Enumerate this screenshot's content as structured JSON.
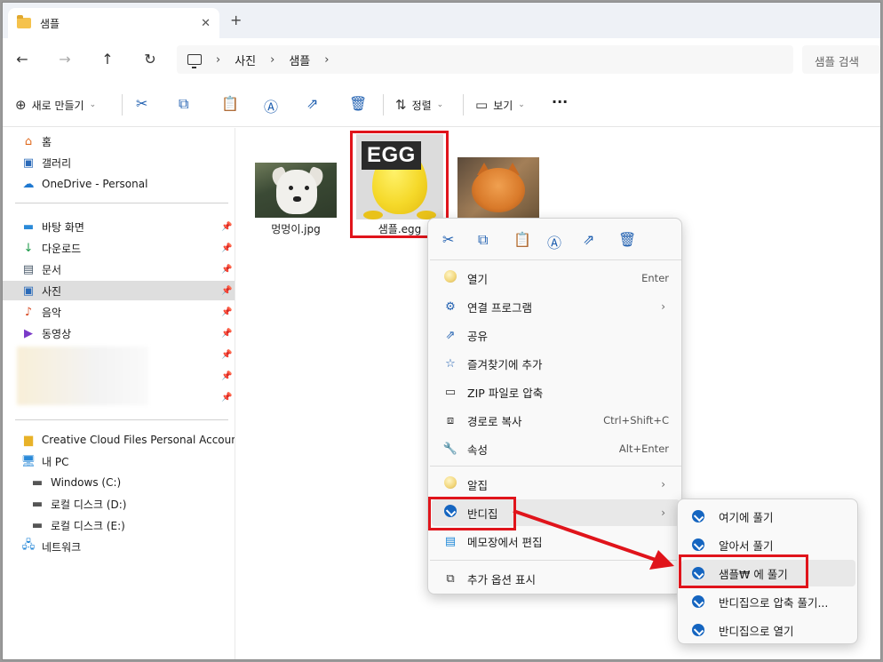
{
  "tab": {
    "title": "샘플",
    "close": "✕",
    "new": "+"
  },
  "address": {
    "crumbs": [
      "사진",
      "샘플"
    ],
    "search_placeholder": "샘플 검색"
  },
  "toolbar": {
    "new_label": "새로 만들기",
    "sort_label": "정렬",
    "view_label": "보기",
    "more": "···"
  },
  "sidebar": {
    "items": [
      {
        "label": "홈",
        "icon": "home-icon"
      },
      {
        "label": "갤러리",
        "icon": "gallery-icon"
      },
      {
        "label": "OneDrive - Personal",
        "icon": "onedrive-icon"
      },
      {
        "label": "바탕 화면",
        "icon": "desktop-icon"
      },
      {
        "label": "다운로드",
        "icon": "download-icon"
      },
      {
        "label": "문서",
        "icon": "documents-icon"
      },
      {
        "label": "사진",
        "icon": "pictures-icon"
      },
      {
        "label": "음악",
        "icon": "music-icon"
      },
      {
        "label": "동영상",
        "icon": "videos-icon"
      },
      {
        "label": "Creative Cloud Files Personal Account lif",
        "icon": "folder-icon"
      },
      {
        "label": "내 PC",
        "icon": "pc-icon"
      },
      {
        "label": "Windows (C:)",
        "icon": "drive-icon"
      },
      {
        "label": "로컬 디스크 (D:)",
        "icon": "drive-icon"
      },
      {
        "label": "로컬 디스크 (E:)",
        "icon": "drive-icon"
      },
      {
        "label": "네트워크",
        "icon": "network-icon"
      }
    ]
  },
  "files": [
    {
      "name": "멍멍이.jpg"
    },
    {
      "name": "샘플.egg",
      "thumb_text": "EGG"
    },
    {
      "name": ""
    }
  ],
  "context_menu": {
    "items": [
      {
        "label": "열기",
        "shortcut": "Enter"
      },
      {
        "label": "연결 프로그램"
      },
      {
        "label": "공유"
      },
      {
        "label": "즐겨찾기에 추가"
      },
      {
        "label": "ZIP 파일로 압축"
      },
      {
        "label": "경로로 복사",
        "shortcut": "Ctrl+Shift+C"
      },
      {
        "label": "속성",
        "shortcut": "Alt+Enter"
      },
      {
        "label": "알집"
      },
      {
        "label": "반디집"
      },
      {
        "label": "메모장에서 편집"
      },
      {
        "label": "추가 옵션 표시"
      }
    ]
  },
  "submenu": {
    "items": [
      {
        "label": "여기에 풀기"
      },
      {
        "label": "알아서 풀기"
      },
      {
        "label": "샘플₩ 에 풀기"
      },
      {
        "label": "반디집으로 압축 풀기..."
      },
      {
        "label": "반디집으로 열기"
      }
    ]
  },
  "colors": {
    "highlight": "#e0141b",
    "accent": "#1f5fb0",
    "bandizip": "#1565c0"
  }
}
